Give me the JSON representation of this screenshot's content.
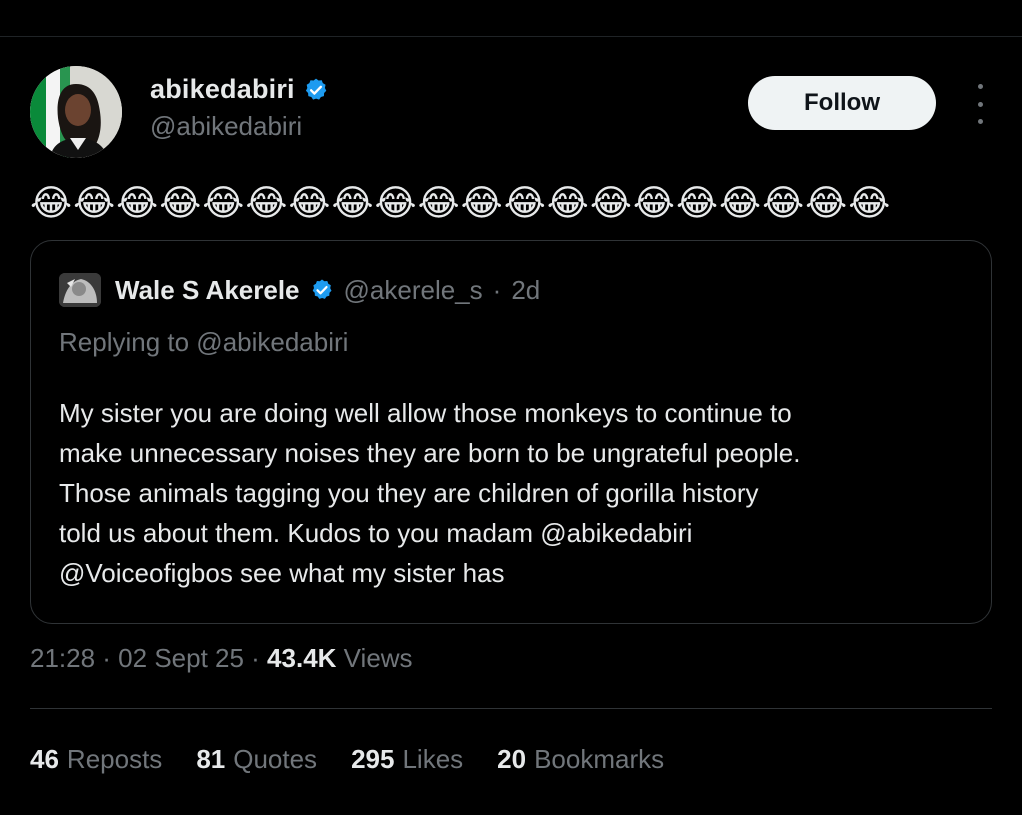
{
  "post": {
    "author": {
      "display_name": "abikedabiri",
      "handle": "@abikedabiri",
      "verified": true
    },
    "follow_label": "Follow",
    "more_icon": "more-vertical-icon",
    "body_emoji": "😂😂😂😂😂😂😂😂😂😂😂😂😂😂😂😂😂😂😂😂",
    "timestamp": "21:28 · 02 Sept 25 · ",
    "views_count": "43.4K",
    "views_label": "Views"
  },
  "quote": {
    "author": {
      "display_name": "Wale S Akerele",
      "handle": "@akerele_s",
      "verified": true
    },
    "separator": "·",
    "time": "2d",
    "replying_to": "Replying to @abikedabiri",
    "lines": [
      "My sister you are doing well allow those monkeys to continue to",
      "make unnecessary noises they are born to be ungrateful people.",
      "Those animals tagging you they are children of gorilla history",
      "told us about them.  Kudos to you madam @abikedabiri",
      "@Voiceofigbos see what my sister has"
    ]
  },
  "stats": {
    "reposts": {
      "count": "46",
      "label": "Reposts"
    },
    "quotes": {
      "count": "81",
      "label": "Quotes"
    },
    "likes": {
      "count": "295",
      "label": "Likes"
    },
    "bookmarks": {
      "count": "20",
      "label": "Bookmarks"
    }
  },
  "colors": {
    "background": "#000000",
    "primary_text": "#e7e9ea",
    "secondary_text": "#71767b",
    "verified_blue": "#1d9bf0",
    "border": "#2f3336",
    "follow_button_bg": "#eff3f4"
  }
}
